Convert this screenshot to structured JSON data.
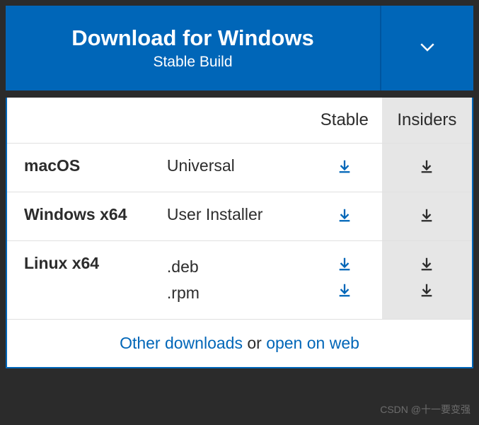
{
  "header": {
    "title": "Download for Windows",
    "subtitle": "Stable Build"
  },
  "columns": {
    "stable": "Stable",
    "insiders": "Insiders"
  },
  "rows": [
    {
      "os": "macOS",
      "variants": [
        "Universal"
      ]
    },
    {
      "os": "Windows x64",
      "variants": [
        "User Installer"
      ]
    },
    {
      "os": "Linux x64",
      "variants": [
        ".deb",
        ".rpm"
      ]
    }
  ],
  "footer": {
    "other_downloads": "Other downloads",
    "or": " or ",
    "open_on_web": "open on web"
  },
  "watermark": "CSDN @十一要变强"
}
